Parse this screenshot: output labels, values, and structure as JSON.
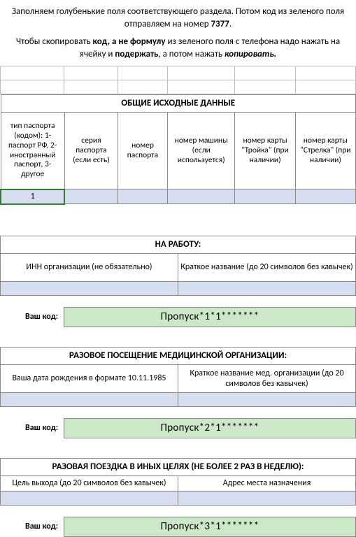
{
  "intro": {
    "prefix": "Заполняем голубенькие поля соответствующего раздела. Потом код из зеленого поля отправляем на номер ",
    "number": "7377",
    "suffix": "."
  },
  "intro2": {
    "part1": "Чтобы скопировать ",
    "bold1": "код, а не формулу",
    "part2": " из зеленого поля с телефона надо нажать на ячейку и ",
    "bold2": "подержать",
    "part3": ", а потом нажать ",
    "italic": "копировать.",
    "part4": ""
  },
  "general": {
    "title": "ОБЩИЕ ИСХОДНЫЕ ДАННЫЕ",
    "headers": {
      "passport_type": "тип паспорта (кодом): 1-паспорт РФ, 2-иностранный паспорт, 3-другое",
      "passport_series": "серия паспорта (если есть)",
      "passport_number": "номер паспорта",
      "car_number": "номер машины (если используется)",
      "troika": "номер карты \"Тройка\" (при наличии)",
      "strelka": "номер карты \"Стрелка\" (при наличии)"
    },
    "values": {
      "passport_type": "1",
      "passport_series": "",
      "passport_number": "",
      "car_number": "",
      "troika": "",
      "strelka": ""
    }
  },
  "work": {
    "title": "НА РАБОТУ:",
    "headers": {
      "inn": "ИНН организации (не обязательно)",
      "short_name": "Краткое название (до 20 символов без кавычек)"
    },
    "values": {
      "inn": "",
      "short_name": ""
    },
    "code_label": "Ваш код:",
    "code_value": "Пропуск*1*1*******"
  },
  "med": {
    "title": "РАЗОВОЕ ПОСЕЩЕНИЕ МЕДИЦИНСКОЙ ОРГАНИЗАЦИИ:",
    "headers": {
      "dob": "Ваша дата рождения в формате 10.11.1985",
      "org": "Краткое название мед. организации (до 20 символов без кавычек)"
    },
    "values": {
      "dob": "",
      "org": ""
    },
    "code_label": "Ваш код:",
    "code_value": "Пропуск*2*1*******"
  },
  "other": {
    "title": "РАЗОВАЯ ПОЕЗДКА В ИНЫХ ЦЕЛЯХ (НЕ БОЛЕЕ 2 РАЗ В НЕДЕЛЮ):",
    "headers": {
      "purpose": "Цель выхода (до 20 символов без кавычек)",
      "address": "Адрес места назначения"
    },
    "values": {
      "purpose": "",
      "address": ""
    },
    "code_label": "Ваш код:",
    "code_value": "Пропуск*3*1*******"
  }
}
